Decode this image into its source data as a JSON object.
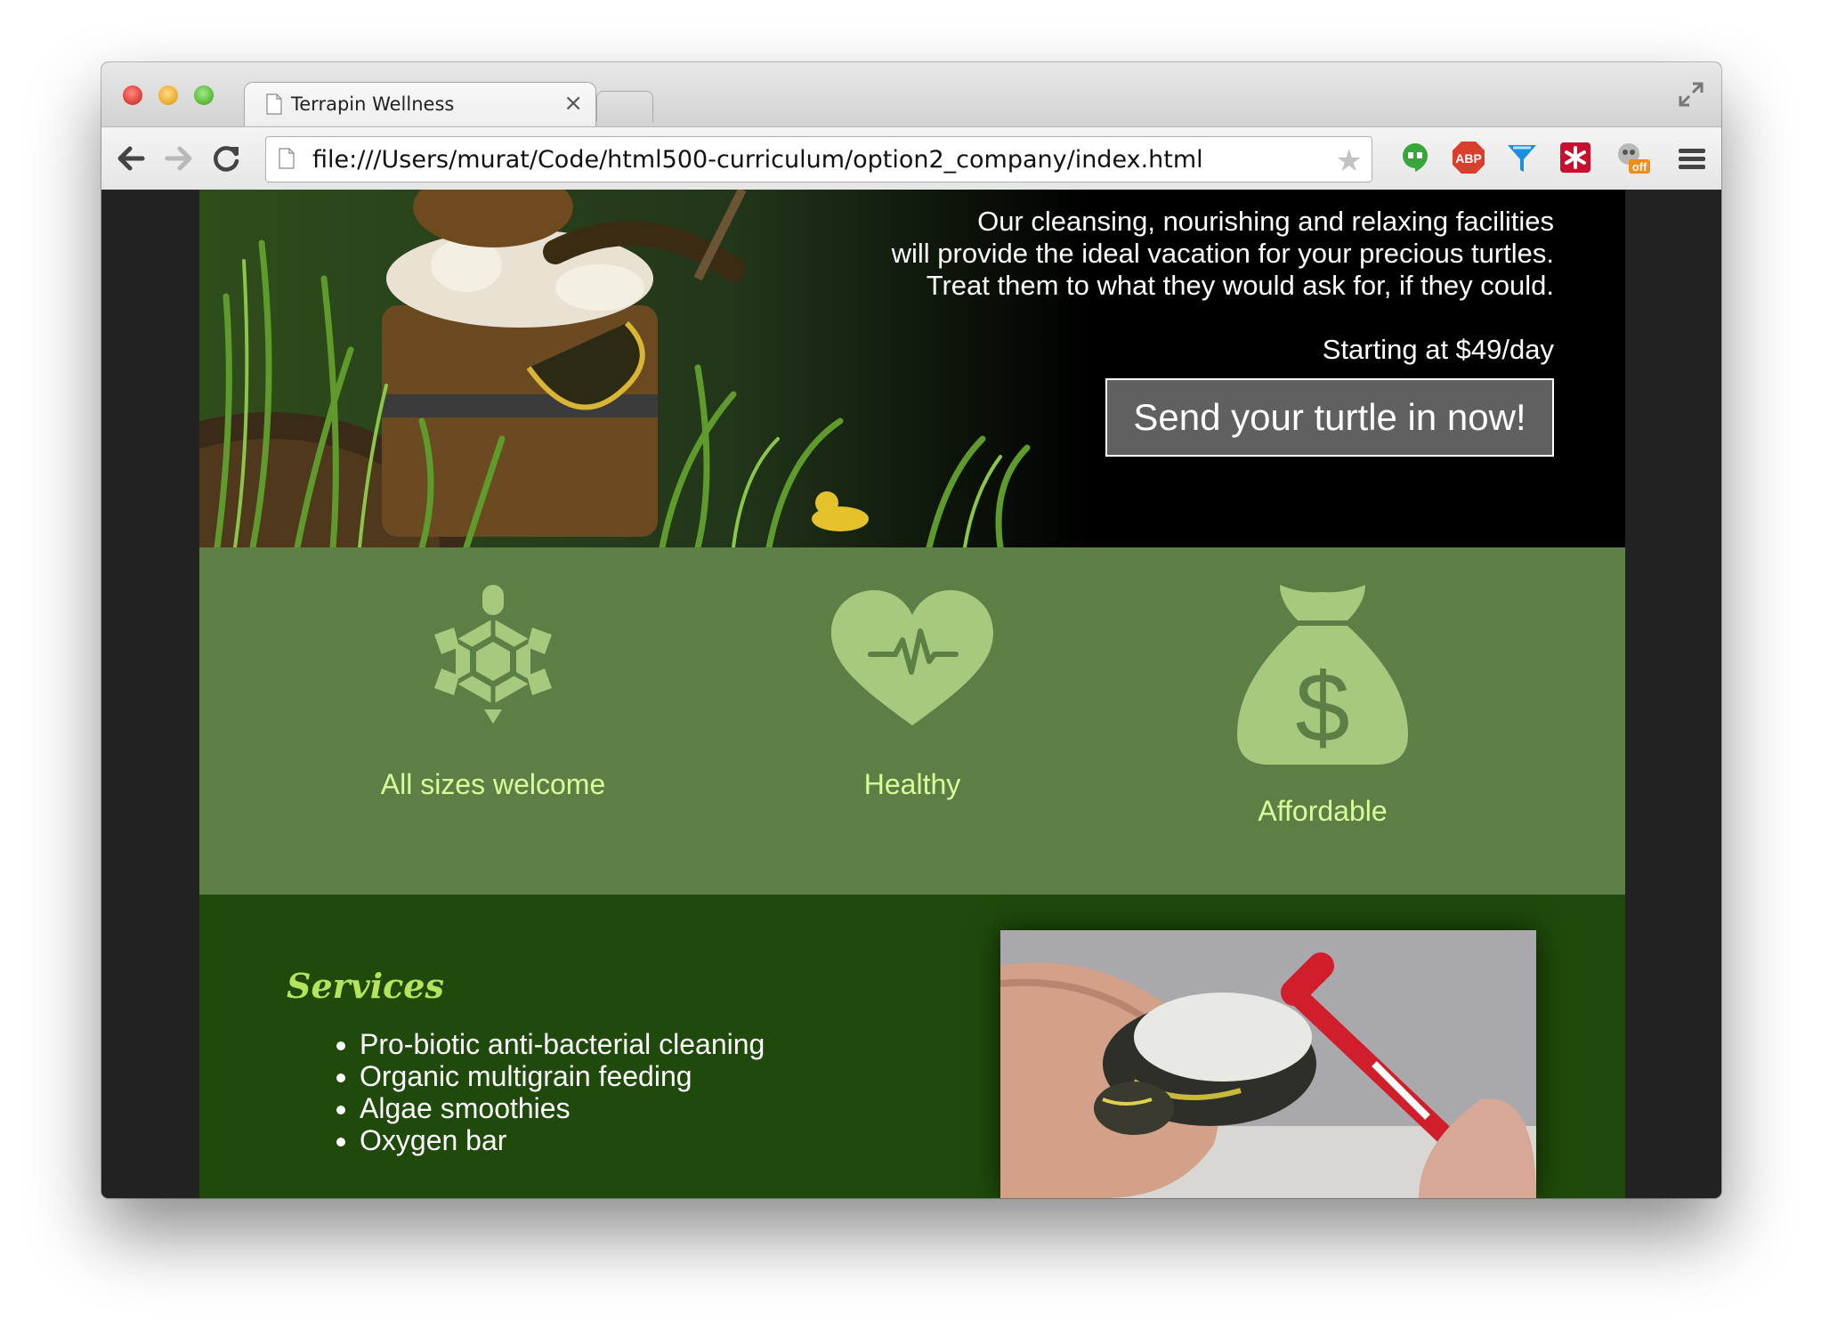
{
  "browser": {
    "tab_title": "Terrapin Wellness",
    "tab_close": "×",
    "address": "file:///Users/murat/Code/html500-curriculum/option2_company/index.html",
    "star": "★",
    "icons": [
      "back-arrow-icon",
      "forward-arrow-icon",
      "reload-icon",
      "hangouts-icon",
      "adblock-plus-icon",
      "extension-funnel-icon",
      "lastpass-icon",
      "off-toggle-extension-icon",
      "menu-icon"
    ],
    "abp_label": "ABP",
    "off_label": "off"
  },
  "hero": {
    "line1": "Our cleansing, nourishing and relaxing facilities",
    "line2": "will provide the ideal vacation for your precious turtles.",
    "line3": "Treat them to what they would ask for, if they could.",
    "price": "Starting at $49/day",
    "cta": "Send your turtle in now!"
  },
  "features": {
    "items": [
      {
        "icon": "turtle-icon",
        "label": "All sizes welcome"
      },
      {
        "icon": "heartbeat-icon",
        "label": "Healthy"
      },
      {
        "icon": "money-bag-icon",
        "label": "Affordable"
      }
    ],
    "dollar": "$"
  },
  "services": {
    "title": "Services",
    "items": [
      "Pro-biotic anti-bacterial cleaning",
      "Organic multigrain feeding",
      "Algae smoothies",
      "Oxygen bar"
    ]
  },
  "colors": {
    "feature_bg": "#5b7f44",
    "feature_icon": "#a6c97e",
    "feature_text": "#d8ff9b",
    "services_bg": "#1f4a0b",
    "services_title": "#b5e35b"
  }
}
